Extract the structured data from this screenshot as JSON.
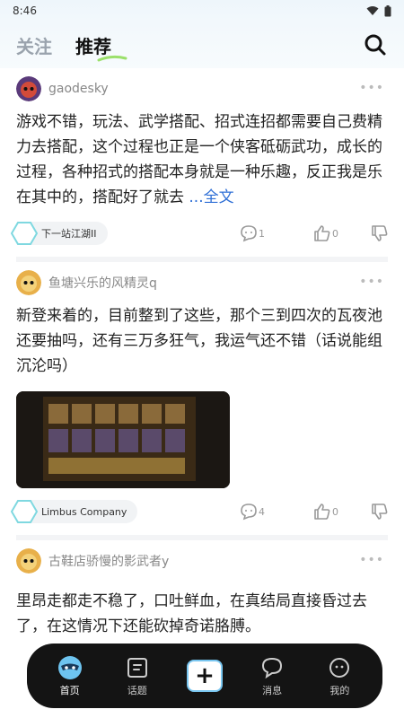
{
  "status": {
    "time": "8:46"
  },
  "header": {
    "tabs": [
      {
        "label": "关注",
        "active": false
      },
      {
        "label": "推荐",
        "active": true
      }
    ],
    "icon": "search-icon"
  },
  "posts": [
    {
      "username": "gaodesky",
      "more": "•••",
      "text": "游戏不错，玩法、武学搭配、招式连招都需要自己费精力去搭配，这个过程也正是一个侠客砥砺武功，成长的过程，各种招式的搭配本身就是一种乐趣，反正我是乐在其中的，搭配好了就去",
      "read_more": "...全文",
      "topic": "下一站江湖II",
      "comments": "1",
      "likes": "0"
    },
    {
      "username": "鱼塘兴乐的风精灵q",
      "more": "•••",
      "text": "新登来着的，目前整到了这些，那个三到四次的瓦夜池还要抽吗，还有三万多狂气，我运气还不错（话说能组沉沦吗）",
      "topic": "Limbus Company",
      "comments": "4",
      "likes": "0"
    },
    {
      "username": "古鞋店骄慢的影武者y",
      "more": "•••",
      "text": "里昂走都走不稳了，口吐鲜血，在真结局直接昏过去了，在这情况下还能砍掉奇诺胳膊。"
    }
  ],
  "nav": {
    "items": [
      {
        "label": "首页",
        "icon": "home-mask-icon",
        "active": true
      },
      {
        "label": "话题",
        "icon": "topic-icon"
      },
      {
        "label": "",
        "icon": "plus-icon"
      },
      {
        "label": "消息",
        "icon": "message-icon"
      },
      {
        "label": "我的",
        "icon": "profile-icon"
      }
    ],
    "post_symbol": "+"
  },
  "colors": {
    "accent_link": "#2f6fd6",
    "nav_bg": "#141414",
    "tab_underline": "#9be06b"
  }
}
